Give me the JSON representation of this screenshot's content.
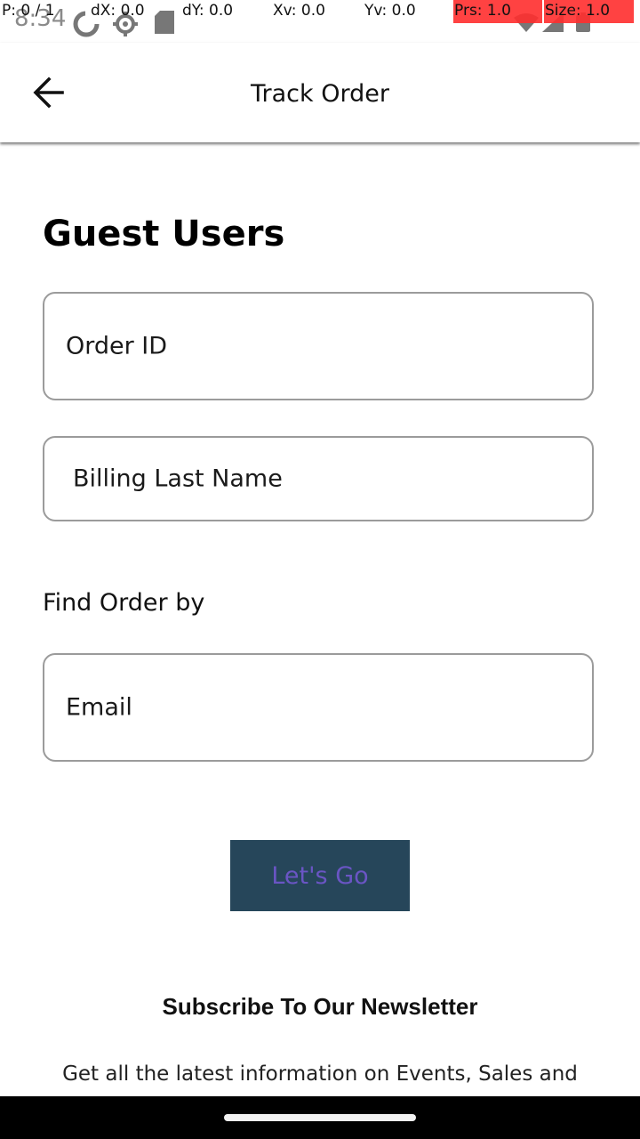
{
  "status_bar": {
    "time": "8:34",
    "icons": [
      "sync-icon",
      "settings-gear-icon",
      "sd-card-icon",
      "wifi-icon",
      "signal-icon",
      "battery-icon"
    ]
  },
  "debug_overlay": {
    "pointer": "P: 0 / 1",
    "dx": "dX: 0.0",
    "dy": "dY: 0.0",
    "xv": "Xv: 0.0",
    "yv": "Yv: 0.0",
    "prs": "Prs: 1.0",
    "size": "Size: 1.0",
    "highlight_color": "#ff2d2d"
  },
  "app_bar": {
    "title": "Track Order",
    "back_icon": "arrow-left-icon"
  },
  "guest_section": {
    "title": "Guest Users",
    "order_id_placeholder": "Order ID",
    "last_name_placeholder": "Billing Last Name"
  },
  "find_by": {
    "label": "Find Order by",
    "email_placeholder": "Email"
  },
  "submit_button": {
    "label": "Let's Go",
    "background": "#26465a",
    "text_color": "#6a55c4"
  },
  "newsletter": {
    "title": "Subscribe To Our Newsletter",
    "text": "Get all the latest information on Events, Sales and"
  }
}
